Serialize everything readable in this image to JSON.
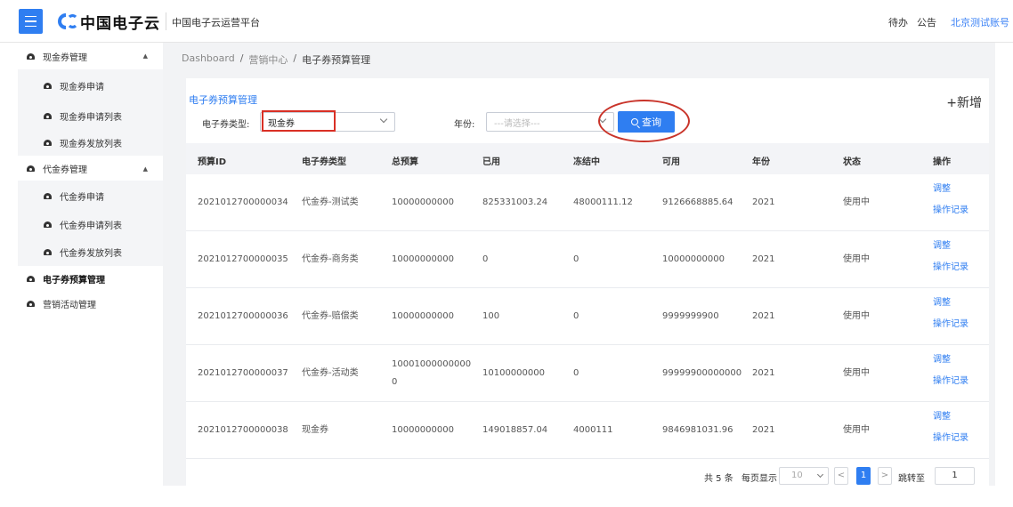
{
  "header": {
    "logo_text": "中国电子云",
    "platform_name": "中国电子云运营平台",
    "todo": "待办",
    "notice": "公告",
    "account": "北京测试账号"
  },
  "sidebar": {
    "groups": [
      {
        "label": "现金券管理",
        "expanded": true,
        "items": [
          "现金券申请",
          "现金券申请列表",
          "现金券发放列表"
        ]
      },
      {
        "label": "代金券管理",
        "expanded": true,
        "items": [
          "代金券申请",
          "代金券申请列表",
          "代金券发放列表"
        ]
      }
    ],
    "budget": "电子券预算管理",
    "marketing": "营销活动管理"
  },
  "breadcrumb": {
    "home": "Dashboard",
    "sep": "/",
    "middle": "营销中心",
    "current": "电子券预算管理"
  },
  "card": {
    "title": "电子券预算管理",
    "add": "+新增"
  },
  "filters": {
    "type_label": "电子券类型:",
    "type_value": "现金券",
    "year_label": "年份:",
    "year_placeholder": "---请选择---",
    "search_label": "查询"
  },
  "table": {
    "columns": [
      "预算ID",
      "电子券类型",
      "总预算",
      "已用",
      "冻结中",
      "可用",
      "年份",
      "状态",
      "操作"
    ],
    "rows": [
      {
        "id": "2021012700000034",
        "type": "代金券-测试类",
        "total": "10000000000",
        "total2": "",
        "used": "825331003.24",
        "frozen": "48000111.12",
        "avail": "9126668885.64",
        "year": "2021",
        "status": "使用中",
        "op1": "调整",
        "op2": "操作记录"
      },
      {
        "id": "2021012700000035",
        "type": "代金券-商务类",
        "total": "10000000000",
        "total2": "",
        "used": "0",
        "frozen": "0",
        "avail": "10000000000",
        "year": "2021",
        "status": "使用中",
        "op1": "调整",
        "op2": "操作记录"
      },
      {
        "id": "2021012700000036",
        "type": "代金券-赔偿类",
        "total": "10000000000",
        "total2": "",
        "used": "100",
        "frozen": "0",
        "avail": "9999999900",
        "year": "2021",
        "status": "使用中",
        "op1": "调整",
        "op2": "操作记录"
      },
      {
        "id": "2021012700000037",
        "type": "代金券-活动类",
        "total": "10001000000000",
        "total2": "0",
        "used": "10100000000",
        "frozen": "0",
        "avail": "99999900000000",
        "year": "2021",
        "status": "使用中",
        "op1": "调整",
        "op2": "操作记录"
      },
      {
        "id": "2021012700000038",
        "type": "现金券",
        "total": "10000000000",
        "total2": "",
        "used": "149018857.04",
        "frozen": "4000111",
        "avail": "9846981031.96",
        "year": "2021",
        "status": "使用中",
        "op1": "调整",
        "op2": "操作记录"
      }
    ]
  },
  "pagination": {
    "total": "共 5 条",
    "page_size_label": "每页显示",
    "page_size": "10",
    "prev": "<",
    "current": "1",
    "next": ">",
    "jump_label": "跳转至",
    "jump_value": "1"
  },
  "colors": {
    "accent": "#2f7ef1",
    "highlight_red": "#d93025"
  }
}
